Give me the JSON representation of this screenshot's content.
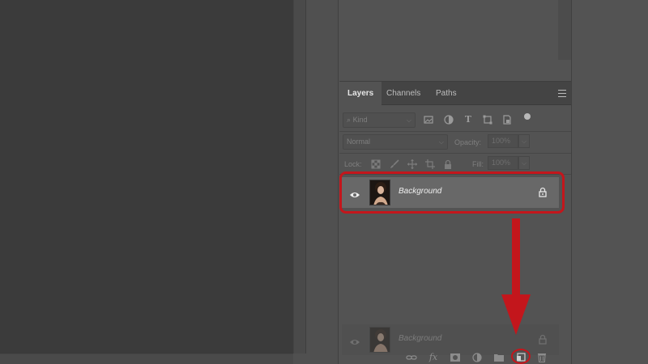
{
  "tabs": [
    {
      "label": "Layers",
      "active": true
    },
    {
      "label": "Channels",
      "active": false
    },
    {
      "label": "Paths",
      "active": false
    }
  ],
  "filter": {
    "kind_label": "Kind"
  },
  "blend": {
    "mode": "Normal",
    "opacity_label": "Opacity:",
    "opacity_value": "100%"
  },
  "locks": {
    "label": "Lock:",
    "fill_label": "Fill:",
    "fill_value": "100%"
  },
  "layers": [
    {
      "name": "Background",
      "visible": true,
      "locked": true,
      "selected": true
    }
  ],
  "ghost_layer": {
    "name": "Background"
  },
  "bottom_icons": [
    "link-icon",
    "fx-icon",
    "mask-icon",
    "adjustment-icon",
    "folder-icon",
    "new-layer-icon",
    "trash-icon"
  ],
  "fx_label": "fx",
  "colors": {
    "annotation": "#c3161c",
    "panel": "#535353",
    "canvas": "#3b3b3b",
    "selected_row": "#686868"
  }
}
